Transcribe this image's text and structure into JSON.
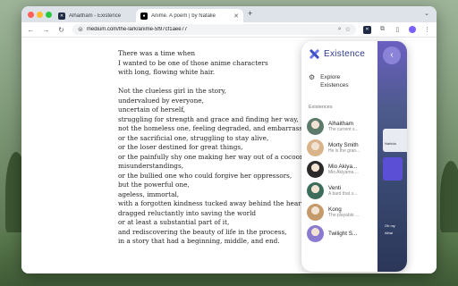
{
  "browser": {
    "tabs": [
      {
        "title": "Alhaitham - Existence",
        "favicon": "existence-favicon",
        "active": false
      },
      {
        "title": "Anime. A poem | by Natalie",
        "favicon": "medium-favicon",
        "active": true
      }
    ],
    "new_tab_label": "+",
    "url": "medium.com/the-lark/anime-5f97cf1aee77"
  },
  "article": {
    "stanzas": [
      [
        "There was a time when",
        "I wanted to be one of those anime characters",
        "with long, flowing white hair."
      ],
      [
        "Not the clueless girl in the story,",
        "undervalued by everyone,",
        "uncertain of herself,",
        "struggling for strength and grace and finding her way,",
        "not the homeless one, feeling degraded, and embarrassed,",
        "or the sacrificial one, struggling to stay alive,",
        "or the loser destined for great things,",
        "or the painfully shy one making her way out of a cocoon of",
        "misunderstandings,",
        "or the bullied one who could forgive her oppressors,",
        "but the powerful one,",
        "ageless, immortal,",
        "with a forgotten kindness tucked away behind the heart,",
        "dragged reluctantly into saving the world",
        "or at least a substantial part of it,",
        "and rediscovering the beauty of life in the process,",
        "in a story that had a beginning, middle, and end."
      ]
    ]
  },
  "panel": {
    "brand": "Existence",
    "explore_label": "Explore Existences",
    "section_label": "Existences",
    "items": [
      {
        "name": "Alhaitham",
        "desc": "The current s...",
        "color": "#5d7a6a"
      },
      {
        "name": "Morty Smith",
        "desc": "He is the gran...",
        "color": "#d9b48a"
      },
      {
        "name": "Mio Akiya...",
        "desc": "Mio Akiyama ...",
        "color": "#2a2a2a"
      },
      {
        "name": "Venti",
        "desc": "A bard that s...",
        "color": "#3b6d5a"
      },
      {
        "name": "Kong",
        "desc": "The playable ...",
        "color": "#c49a6b"
      },
      {
        "name": "Twilight S...",
        "desc": "",
        "color": "#8a7ad0"
      }
    ],
    "side_text": [
      "Nahida",
      "Oh my",
      "Alhai"
    ]
  },
  "colors": {
    "accent": "#2d3a8c",
    "collapse": "#8a83d8"
  }
}
